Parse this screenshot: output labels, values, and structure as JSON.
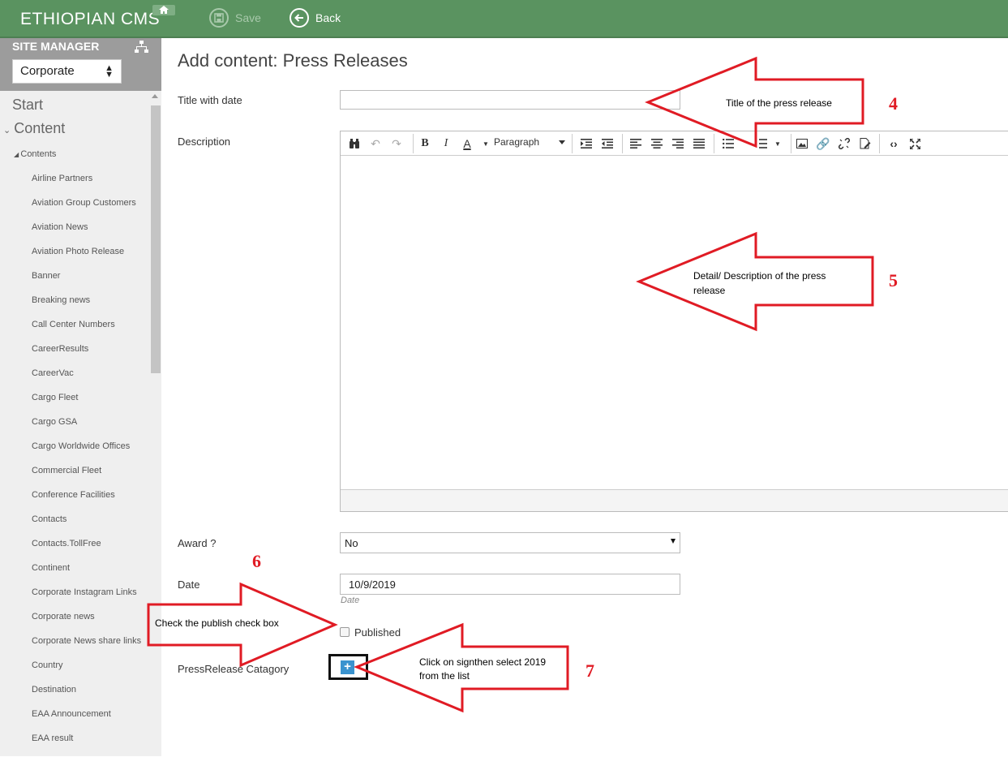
{
  "app": {
    "title": "ETHIOPIAN CMS"
  },
  "toolbar": {
    "save_label": "Save",
    "back_label": "Back"
  },
  "sidebar": {
    "header": "SITE MANAGER",
    "site_selected": "Corporate",
    "start_label": "Start",
    "content_label": "Content",
    "contents_label": "Contents",
    "items": [
      "Airline Partners",
      "Aviation Group Customers",
      "Aviation News",
      "Aviation Photo Release",
      "Banner",
      "Breaking news",
      "Call Center Numbers",
      "CareerResults",
      "CareerVac",
      "Cargo Fleet",
      "Cargo GSA",
      "Cargo Worldwide Offices",
      "Commercial Fleet",
      "Conference Facilities",
      "Contacts",
      "Contacts.TollFree",
      "Continent",
      "Corporate Instagram Links",
      "Corporate news",
      "Corporate News share links",
      "Country",
      "Destination",
      "EAA Announcement",
      "EAA result"
    ]
  },
  "main": {
    "page_title": "Add content: Press Releases",
    "fields": {
      "title_label": "Title with date",
      "title_value": "",
      "description_label": "Description",
      "paragraph_format": "Paragraph",
      "award_label": "Award ?",
      "award_value": "No",
      "date_label": "Date",
      "date_value": "10/9/2019",
      "date_hint": "Date",
      "published_label": "Published",
      "published_checked": false,
      "category_label": "PressRelease Catagory"
    }
  },
  "annotations": {
    "a4_text": "Title of the press release",
    "a4_num": "4",
    "a5_text": "Detail/ Description of the press release",
    "a5_num": "5",
    "a6_text": "Check the publish check box",
    "a6_num": "6",
    "a7_text": "Click on signthen select 2019 from the list",
    "a7_num": "7",
    "arrow_color": "#e01b24"
  },
  "icons": {
    "editor_toolbar": [
      "find-replace-icon",
      "undo-icon",
      "redo-icon",
      "bold-icon",
      "italic-icon",
      "text-color-icon",
      "paragraph-format-select",
      "indent-icon",
      "outdent-icon",
      "align-left-icon",
      "align-center-icon",
      "align-right-icon",
      "align-justify-icon",
      "bullet-list-icon",
      "numbered-list-icon",
      "image-icon",
      "link-icon",
      "unlink-icon",
      "document-edit-icon",
      "source-code-icon",
      "fullscreen-icon"
    ]
  }
}
